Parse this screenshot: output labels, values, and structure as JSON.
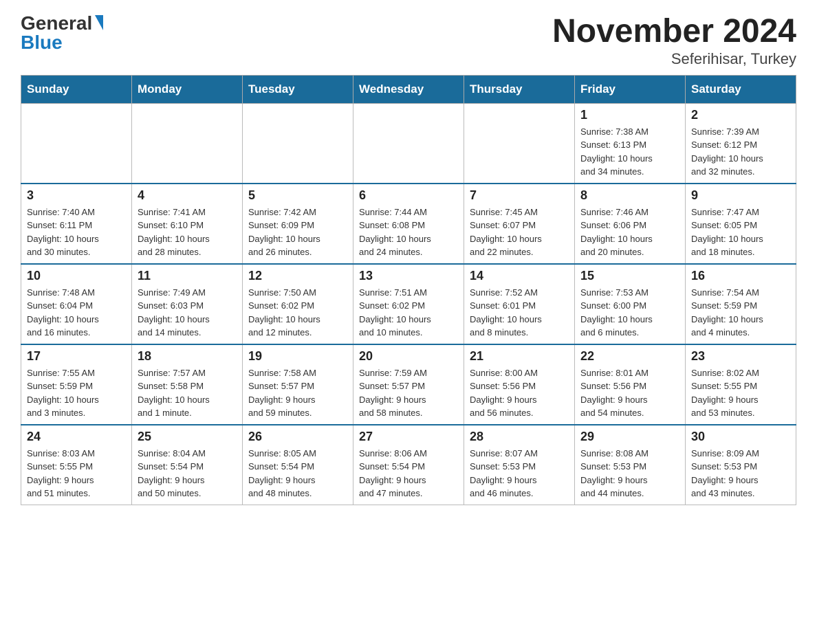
{
  "header": {
    "logo_general": "General",
    "logo_blue": "Blue",
    "title": "November 2024",
    "subtitle": "Seferihisar, Turkey"
  },
  "weekdays": [
    "Sunday",
    "Monday",
    "Tuesday",
    "Wednesday",
    "Thursday",
    "Friday",
    "Saturday"
  ],
  "weeks": [
    [
      {
        "day": "",
        "info": ""
      },
      {
        "day": "",
        "info": ""
      },
      {
        "day": "",
        "info": ""
      },
      {
        "day": "",
        "info": ""
      },
      {
        "day": "",
        "info": ""
      },
      {
        "day": "1",
        "info": "Sunrise: 7:38 AM\nSunset: 6:13 PM\nDaylight: 10 hours\nand 34 minutes."
      },
      {
        "day": "2",
        "info": "Sunrise: 7:39 AM\nSunset: 6:12 PM\nDaylight: 10 hours\nand 32 minutes."
      }
    ],
    [
      {
        "day": "3",
        "info": "Sunrise: 7:40 AM\nSunset: 6:11 PM\nDaylight: 10 hours\nand 30 minutes."
      },
      {
        "day": "4",
        "info": "Sunrise: 7:41 AM\nSunset: 6:10 PM\nDaylight: 10 hours\nand 28 minutes."
      },
      {
        "day": "5",
        "info": "Sunrise: 7:42 AM\nSunset: 6:09 PM\nDaylight: 10 hours\nand 26 minutes."
      },
      {
        "day": "6",
        "info": "Sunrise: 7:44 AM\nSunset: 6:08 PM\nDaylight: 10 hours\nand 24 minutes."
      },
      {
        "day": "7",
        "info": "Sunrise: 7:45 AM\nSunset: 6:07 PM\nDaylight: 10 hours\nand 22 minutes."
      },
      {
        "day": "8",
        "info": "Sunrise: 7:46 AM\nSunset: 6:06 PM\nDaylight: 10 hours\nand 20 minutes."
      },
      {
        "day": "9",
        "info": "Sunrise: 7:47 AM\nSunset: 6:05 PM\nDaylight: 10 hours\nand 18 minutes."
      }
    ],
    [
      {
        "day": "10",
        "info": "Sunrise: 7:48 AM\nSunset: 6:04 PM\nDaylight: 10 hours\nand 16 minutes."
      },
      {
        "day": "11",
        "info": "Sunrise: 7:49 AM\nSunset: 6:03 PM\nDaylight: 10 hours\nand 14 minutes."
      },
      {
        "day": "12",
        "info": "Sunrise: 7:50 AM\nSunset: 6:02 PM\nDaylight: 10 hours\nand 12 minutes."
      },
      {
        "day": "13",
        "info": "Sunrise: 7:51 AM\nSunset: 6:02 PM\nDaylight: 10 hours\nand 10 minutes."
      },
      {
        "day": "14",
        "info": "Sunrise: 7:52 AM\nSunset: 6:01 PM\nDaylight: 10 hours\nand 8 minutes."
      },
      {
        "day": "15",
        "info": "Sunrise: 7:53 AM\nSunset: 6:00 PM\nDaylight: 10 hours\nand 6 minutes."
      },
      {
        "day": "16",
        "info": "Sunrise: 7:54 AM\nSunset: 5:59 PM\nDaylight: 10 hours\nand 4 minutes."
      }
    ],
    [
      {
        "day": "17",
        "info": "Sunrise: 7:55 AM\nSunset: 5:59 PM\nDaylight: 10 hours\nand 3 minutes."
      },
      {
        "day": "18",
        "info": "Sunrise: 7:57 AM\nSunset: 5:58 PM\nDaylight: 10 hours\nand 1 minute."
      },
      {
        "day": "19",
        "info": "Sunrise: 7:58 AM\nSunset: 5:57 PM\nDaylight: 9 hours\nand 59 minutes."
      },
      {
        "day": "20",
        "info": "Sunrise: 7:59 AM\nSunset: 5:57 PM\nDaylight: 9 hours\nand 58 minutes."
      },
      {
        "day": "21",
        "info": "Sunrise: 8:00 AM\nSunset: 5:56 PM\nDaylight: 9 hours\nand 56 minutes."
      },
      {
        "day": "22",
        "info": "Sunrise: 8:01 AM\nSunset: 5:56 PM\nDaylight: 9 hours\nand 54 minutes."
      },
      {
        "day": "23",
        "info": "Sunrise: 8:02 AM\nSunset: 5:55 PM\nDaylight: 9 hours\nand 53 minutes."
      }
    ],
    [
      {
        "day": "24",
        "info": "Sunrise: 8:03 AM\nSunset: 5:55 PM\nDaylight: 9 hours\nand 51 minutes."
      },
      {
        "day": "25",
        "info": "Sunrise: 8:04 AM\nSunset: 5:54 PM\nDaylight: 9 hours\nand 50 minutes."
      },
      {
        "day": "26",
        "info": "Sunrise: 8:05 AM\nSunset: 5:54 PM\nDaylight: 9 hours\nand 48 minutes."
      },
      {
        "day": "27",
        "info": "Sunrise: 8:06 AM\nSunset: 5:54 PM\nDaylight: 9 hours\nand 47 minutes."
      },
      {
        "day": "28",
        "info": "Sunrise: 8:07 AM\nSunset: 5:53 PM\nDaylight: 9 hours\nand 46 minutes."
      },
      {
        "day": "29",
        "info": "Sunrise: 8:08 AM\nSunset: 5:53 PM\nDaylight: 9 hours\nand 44 minutes."
      },
      {
        "day": "30",
        "info": "Sunrise: 8:09 AM\nSunset: 5:53 PM\nDaylight: 9 hours\nand 43 minutes."
      }
    ]
  ]
}
